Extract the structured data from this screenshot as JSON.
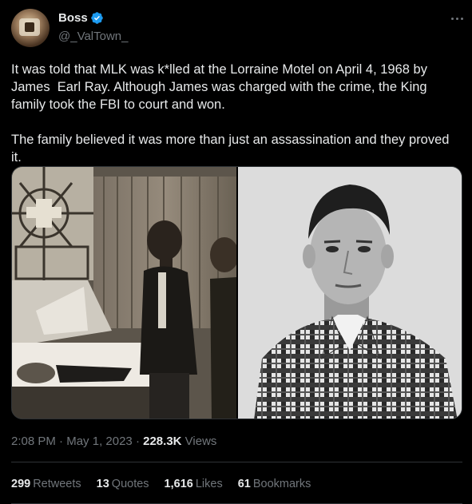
{
  "author": {
    "name": "Boss",
    "handle": "@_ValTown_"
  },
  "tweet": {
    "text": "It was told that MLK was k*lled at the Lorraine Motel on April 4, 1968 by James  Earl Ray. Although James was charged with the crime, the King family took the FBI to court and won.\n\nThe family believed it was more than just an assassination and they proved it."
  },
  "meta": {
    "time": "2:08 PM",
    "sep1": "·",
    "date": "May 1, 2023",
    "sep2": "·",
    "views_count": "228.3K",
    "views_label": "Views"
  },
  "stats": {
    "retweets": {
      "count": "299",
      "label": "Retweets"
    },
    "quotes": {
      "count": "13",
      "label": "Quotes"
    },
    "likes": {
      "count": "1,616",
      "label": "Likes"
    },
    "bookmarks": {
      "count": "61",
      "label": "Bookmarks"
    }
  },
  "icons": {
    "verified": "verified-badge-icon",
    "more": "more-options-icon"
  },
  "colors": {
    "background": "#000000",
    "text": "#e7e9ea",
    "secondary": "#71767b",
    "verified": "#1d9bf0",
    "divider": "#2f3336"
  }
}
